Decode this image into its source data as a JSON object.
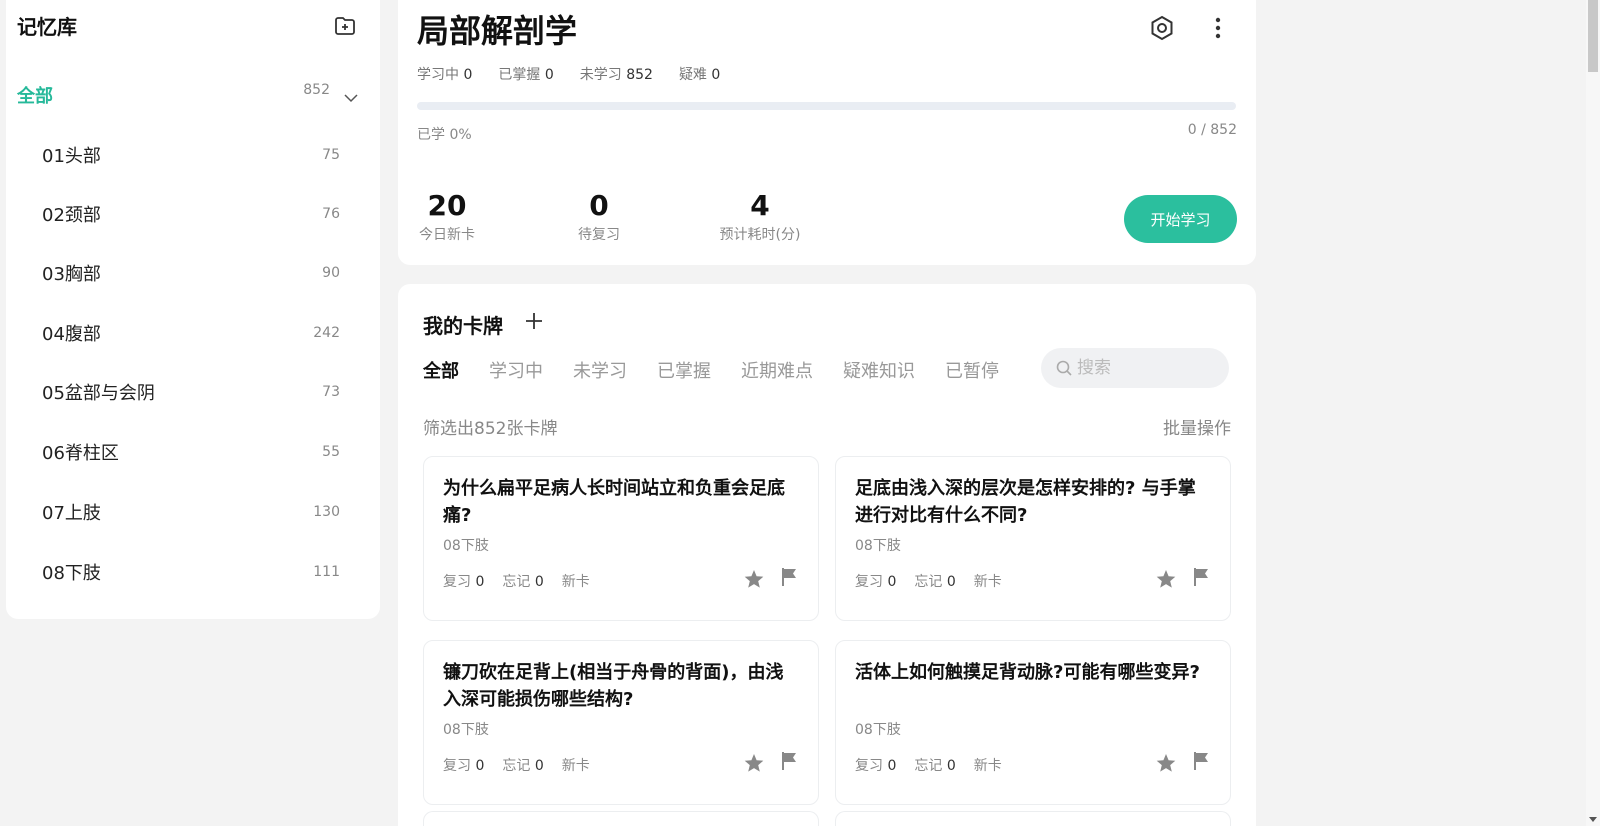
{
  "sidebar": {
    "title": "记忆库",
    "add_icon": "folder-plus-icon",
    "all": {
      "label": "全部",
      "count": "852"
    },
    "items": [
      {
        "label": "01头部",
        "count": "75"
      },
      {
        "label": "02颈部",
        "count": "76"
      },
      {
        "label": "03胸部",
        "count": "90"
      },
      {
        "label": "04腹部",
        "count": "242"
      },
      {
        "label": "05盆部与会阴",
        "count": "73"
      },
      {
        "label": "06脊柱区",
        "count": "55"
      },
      {
        "label": "07上肢",
        "count": "130"
      },
      {
        "label": "08下肢",
        "count": "111"
      }
    ]
  },
  "deck": {
    "title": "局部解剖学",
    "stats": [
      {
        "label": "学习中",
        "value": "0"
      },
      {
        "label": "已掌握",
        "value": "0"
      },
      {
        "label": "未学习",
        "value": "852"
      },
      {
        "label": "疑难",
        "value": "0"
      }
    ],
    "progress_fraction": 0,
    "learned_pct_text": "已学 0%",
    "learned_count_text": "0 / 852",
    "metrics": [
      {
        "value": "20",
        "label": "今日新卡"
      },
      {
        "value": "0",
        "label": "待复习"
      },
      {
        "value": "4",
        "label": "预计耗时(分)"
      }
    ],
    "start_label": "开始学习"
  },
  "cards_panel": {
    "title": "我的卡牌",
    "tabs": [
      "全部",
      "学习中",
      "未学习",
      "已掌握",
      "近期难点",
      "疑难知识",
      "已暂停"
    ],
    "search_placeholder": "搜索",
    "filter_count": "筛选出852张卡牌",
    "bulk_label": "批量操作",
    "cards": [
      {
        "question": "为什么扁平足病人长时间站立和负重会足底痛?",
        "tag": "08下肢",
        "review_label": "复习",
        "review": "0",
        "forget_label": "忘记",
        "forget": "0",
        "status": "新卡"
      },
      {
        "question": "足底由浅入深的层次是怎样安排的? 与手掌进行对比有什么不同?",
        "tag": "08下肢",
        "review_label": "复习",
        "review": "0",
        "forget_label": "忘记",
        "forget": "0",
        "status": "新卡"
      },
      {
        "question": "镰刀砍在足背上(相当于舟骨的背面)，由浅入深可能损伤哪些结构?",
        "tag": "08下肢",
        "review_label": "复习",
        "review": "0",
        "forget_label": "忘记",
        "forget": "0",
        "status": "新卡"
      },
      {
        "question": "活体上如何触摸足背动脉?可能有哪些变异?",
        "tag": "08下肢",
        "review_label": "复习",
        "review": "0",
        "forget_label": "忘记",
        "forget": "0",
        "status": "新卡"
      }
    ]
  },
  "colors": {
    "accent": "#26b99a",
    "button": "#2bbf9e"
  }
}
